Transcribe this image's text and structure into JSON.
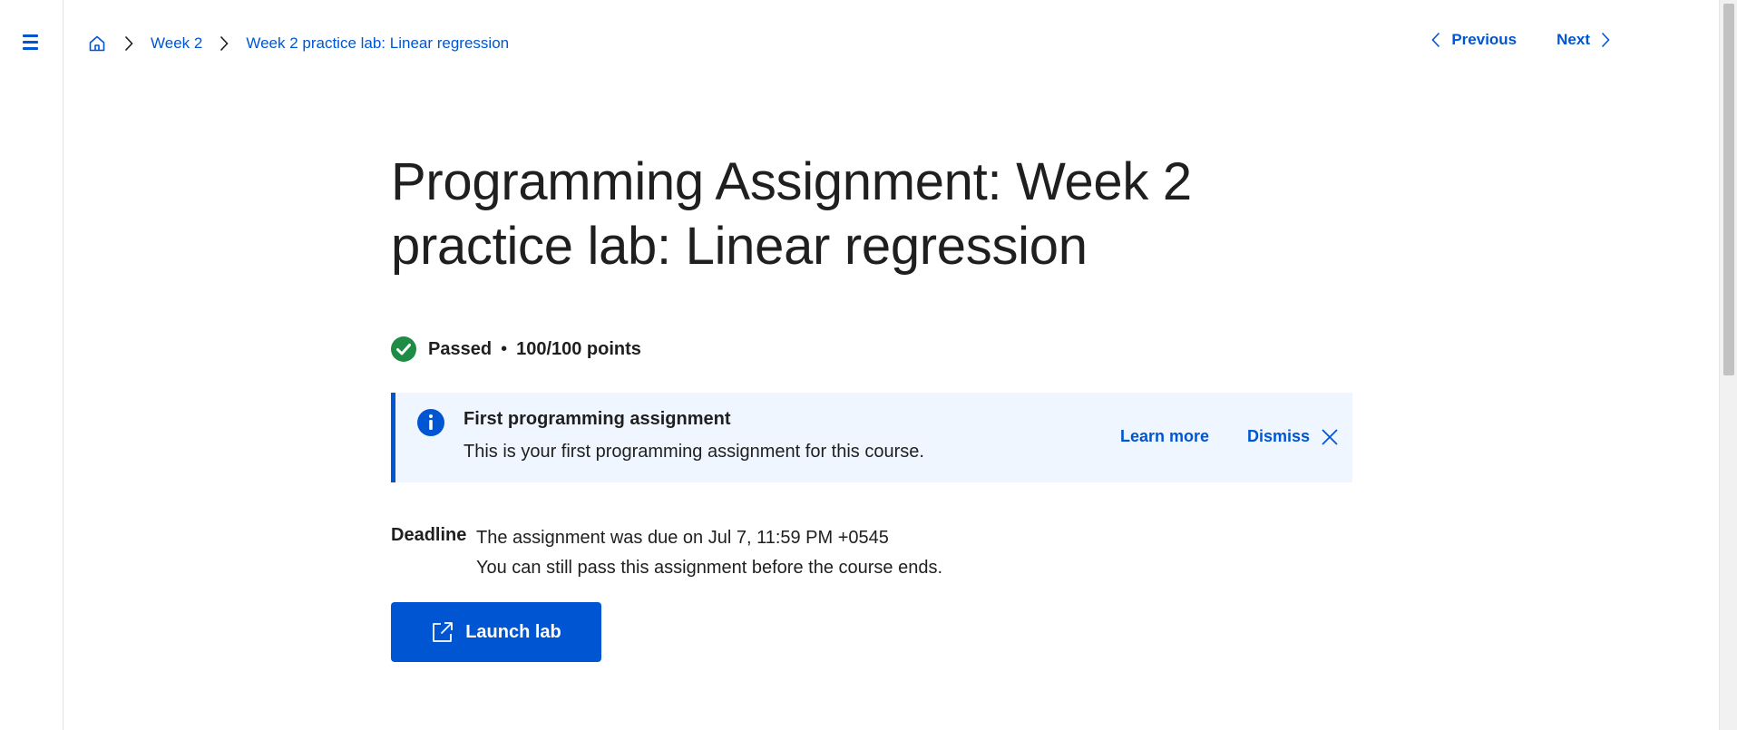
{
  "nav": {
    "menu_icon": "hamburger-menu-icon",
    "breadcrumb": {
      "home_icon": "home-icon",
      "items": [
        {
          "label": "Week 2"
        },
        {
          "label": "Week 2 practice lab: Linear regression"
        }
      ]
    },
    "pager": {
      "previous_label": "Previous",
      "next_label": "Next"
    }
  },
  "page": {
    "title": "Programming Assignment: Week 2 practice lab: Linear regression",
    "status": {
      "label": "Passed",
      "separator": "•",
      "points": "100/100 points",
      "status_color": "#1e8c45"
    },
    "banner": {
      "title": "First programming assignment",
      "body": "This is your first programming assignment for this course.",
      "learn_more_label": "Learn more",
      "dismiss_label": "Dismiss"
    },
    "deadline": {
      "label": "Deadline",
      "line1": "The assignment was due on Jul 7, 11:59 PM +0545",
      "line2": "You can still pass this assignment before the course ends."
    },
    "launch_button_label": "Launch lab"
  },
  "colors": {
    "accent": "#0056d2",
    "banner_bg": "#f0f6ff",
    "text": "#1f1f1f"
  }
}
